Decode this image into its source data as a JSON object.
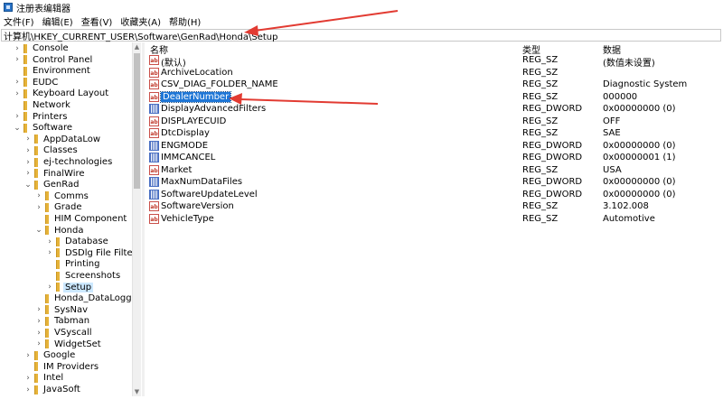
{
  "window": {
    "title": "注册表编辑器"
  },
  "menu": [
    "文件(F)",
    "编辑(E)",
    "查看(V)",
    "收藏夹(A)",
    "帮助(H)"
  ],
  "address": "计算机\\HKEY_CURRENT_USER\\Software\\GenRad\\Honda\\Setup",
  "tree": [
    {
      "label": "Console",
      "level": 0,
      "expander": "›",
      "selected": false
    },
    {
      "label": "Control Panel",
      "level": 0,
      "expander": "›",
      "selected": false
    },
    {
      "label": "Environment",
      "level": 0,
      "expander": "",
      "selected": false
    },
    {
      "label": "EUDC",
      "level": 0,
      "expander": "›",
      "selected": false
    },
    {
      "label": "Keyboard Layout",
      "level": 0,
      "expander": "›",
      "selected": false
    },
    {
      "label": "Network",
      "level": 0,
      "expander": "",
      "selected": false
    },
    {
      "label": "Printers",
      "level": 0,
      "expander": "›",
      "selected": false
    },
    {
      "label": "Software",
      "level": 0,
      "expander": "⌄",
      "selected": false
    },
    {
      "label": "AppDataLow",
      "level": 1,
      "expander": "›",
      "selected": false
    },
    {
      "label": "Classes",
      "level": 1,
      "expander": "›",
      "selected": false
    },
    {
      "label": "ej-technologies",
      "level": 1,
      "expander": "›",
      "selected": false
    },
    {
      "label": "FinalWire",
      "level": 1,
      "expander": "›",
      "selected": false
    },
    {
      "label": "GenRad",
      "level": 1,
      "expander": "⌄",
      "selected": false
    },
    {
      "label": "Comms",
      "level": 2,
      "expander": "›",
      "selected": false
    },
    {
      "label": "Grade",
      "level": 2,
      "expander": "›",
      "selected": false
    },
    {
      "label": "HIM Component",
      "level": 2,
      "expander": "",
      "selected": false
    },
    {
      "label": "Honda",
      "level": 2,
      "expander": "⌄",
      "selected": false
    },
    {
      "label": "Database",
      "level": 3,
      "expander": "›",
      "selected": false
    },
    {
      "label": "DSDlg File Filters",
      "level": 3,
      "expander": "›",
      "selected": false
    },
    {
      "label": "Printing",
      "level": 3,
      "expander": "",
      "selected": false
    },
    {
      "label": "Screenshots",
      "level": 3,
      "expander": "",
      "selected": false
    },
    {
      "label": "Setup",
      "level": 3,
      "expander": "›",
      "selected": true
    },
    {
      "label": "Honda_DataLogger",
      "level": 2,
      "expander": "",
      "selected": false
    },
    {
      "label": "SysNav",
      "level": 2,
      "expander": "›",
      "selected": false
    },
    {
      "label": "Tabman",
      "level": 2,
      "expander": "›",
      "selected": false
    },
    {
      "label": "VSyscall",
      "level": 2,
      "expander": "›",
      "selected": false
    },
    {
      "label": "WidgetSet",
      "level": 2,
      "expander": "›",
      "selected": false
    },
    {
      "label": "Google",
      "level": 1,
      "expander": "›",
      "selected": false
    },
    {
      "label": "IM Providers",
      "level": 1,
      "expander": "",
      "selected": false
    },
    {
      "label": "Intel",
      "level": 1,
      "expander": "›",
      "selected": false
    },
    {
      "label": "JavaSoft",
      "level": 1,
      "expander": "›",
      "selected": false
    }
  ],
  "columns": {
    "name": "名称",
    "type": "类型",
    "data": "数据"
  },
  "values": [
    {
      "name": "(默认)",
      "type": "REG_SZ",
      "data": "(数值未设置)",
      "kind": "sz",
      "icon_text": "ab",
      "selected": false
    },
    {
      "name": "ArchiveLocation",
      "type": "REG_SZ",
      "data": "",
      "kind": "sz",
      "icon_text": "ab",
      "selected": false
    },
    {
      "name": "CSV_DIAG_FOLDER_NAME",
      "type": "REG_SZ",
      "data": "Diagnostic System",
      "kind": "sz",
      "icon_text": "ab",
      "selected": false
    },
    {
      "name": "DealerNumber",
      "type": "REG_SZ",
      "data": "000000",
      "kind": "sz",
      "icon_text": "ab",
      "selected": true
    },
    {
      "name": "DisplayAdvancedFilters",
      "type": "REG_DWORD",
      "data": "0x00000000 (0)",
      "kind": "bin",
      "icon_text": "",
      "selected": false
    },
    {
      "name": "DISPLAYECUID",
      "type": "REG_SZ",
      "data": "OFF",
      "kind": "sz",
      "icon_text": "ab",
      "selected": false
    },
    {
      "name": "DtcDisplay",
      "type": "REG_SZ",
      "data": "SAE",
      "kind": "sz",
      "icon_text": "ab",
      "selected": false
    },
    {
      "name": "ENGMODE",
      "type": "REG_DWORD",
      "data": "0x00000000 (0)",
      "kind": "bin",
      "icon_text": "",
      "selected": false
    },
    {
      "name": "IMMCANCEL",
      "type": "REG_DWORD",
      "data": "0x00000001 (1)",
      "kind": "bin",
      "icon_text": "",
      "selected": false
    },
    {
      "name": "Market",
      "type": "REG_SZ",
      "data": "USA",
      "kind": "sz",
      "icon_text": "ab",
      "selected": false
    },
    {
      "name": "MaxNumDataFiles",
      "type": "REG_DWORD",
      "data": "0x00000000 (0)",
      "kind": "bin",
      "icon_text": "",
      "selected": false
    },
    {
      "name": "SoftwareUpdateLevel",
      "type": "REG_DWORD",
      "data": "0x00000000 (0)",
      "kind": "bin",
      "icon_text": "",
      "selected": false
    },
    {
      "name": "SoftwareVersion",
      "type": "REG_SZ",
      "data": "3.102.008",
      "kind": "sz",
      "icon_text": "ab",
      "selected": false
    },
    {
      "name": "VehicleType",
      "type": "REG_SZ",
      "data": "Automotive",
      "kind": "sz",
      "icon_text": "ab",
      "selected": false
    }
  ],
  "annotations": {
    "arrow_color": "#e23b32"
  }
}
